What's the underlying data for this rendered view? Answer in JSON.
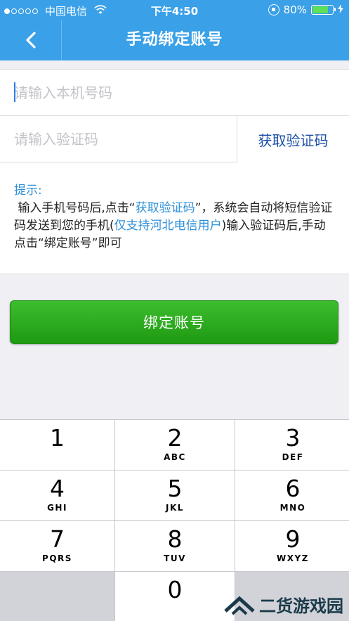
{
  "status_bar": {
    "carrier": "中国电信",
    "time": "下午4:50",
    "battery_percent": "80%",
    "battery_level": 0.8
  },
  "nav": {
    "title": "手动绑定账号"
  },
  "form": {
    "phone_placeholder": "请输入本机号码",
    "code_placeholder": "请输入验证码",
    "get_code_label": "获取验证码"
  },
  "tip": {
    "label": "提示:",
    "part1": " 输入手机号码后,点击“",
    "link1": "获取验证码",
    "part2": "”，系统会自动将短信验证码发送到您的手机(",
    "link2": "仅支持河北电信用户",
    "part3": ")输入验证码后,手动点击“绑定账号”即可"
  },
  "bind_button": "绑定账号",
  "keypad": {
    "keys": [
      {
        "num": "1",
        "letters": ""
      },
      {
        "num": "2",
        "letters": "ABC"
      },
      {
        "num": "3",
        "letters": "DEF"
      },
      {
        "num": "4",
        "letters": "GHI"
      },
      {
        "num": "5",
        "letters": "JKL"
      },
      {
        "num": "6",
        "letters": "MNO"
      },
      {
        "num": "7",
        "letters": "PQRS"
      },
      {
        "num": "8",
        "letters": "TUV"
      },
      {
        "num": "9",
        "letters": "WXYZ"
      },
      {
        "num": "0",
        "letters": ""
      }
    ]
  },
  "watermark": "二货游戏园",
  "colors": {
    "nav_bg": "#3aa0e8",
    "accent_blue": "#2b8fd8",
    "button_green": "#2aaa1f"
  },
  "icons": {
    "back": "chevron-left-icon",
    "wifi": "wifi-icon",
    "battery": "battery-icon",
    "rotation_lock": "rotation-lock-icon",
    "charging": "bolt-icon"
  }
}
